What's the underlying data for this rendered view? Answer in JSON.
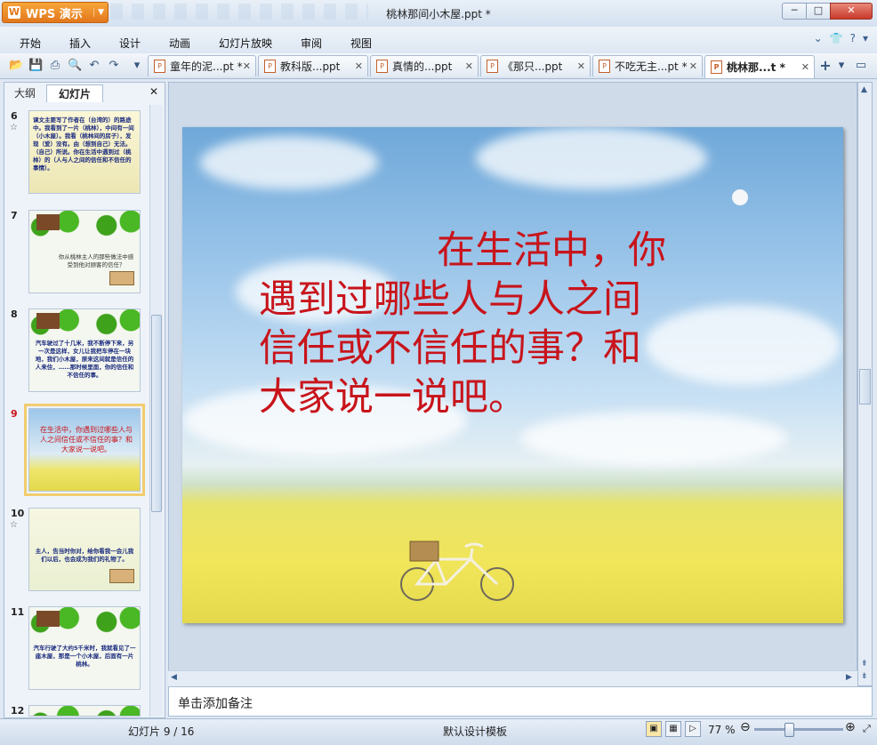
{
  "app": {
    "button_label": "WPS 演示",
    "window_title": "桃林那间小木屋.ppt *"
  },
  "window_controls": {
    "minimize": "─",
    "maximize": "□",
    "close": "✕"
  },
  "menu": [
    "开始",
    "插入",
    "设计",
    "动画",
    "幻灯片放映",
    "审阅",
    "视图"
  ],
  "doc_tabs": [
    {
      "label": "童年的泥...pt *"
    },
    {
      "label": "教科版...ppt"
    },
    {
      "label": "真情的...ppt"
    },
    {
      "label": "《那只...ppt"
    },
    {
      "label": "不吃无主...pt *"
    },
    {
      "label": "桃林那...t *",
      "active": true
    }
  ],
  "left_panel": {
    "tab_outline": "大纲",
    "tab_slides": "幻灯片",
    "close": "✕"
  },
  "slides": [
    {
      "num": "6",
      "star": "☆",
      "text": "课文主要写了作者在（台湾的）的路途中。我看到了一片（桃林），中间有一间（小木屋）。我看（桃林间的房子），发现（爱）没有。由（想到自己）无法。（自己）所说。你在生活中遇到过（桃林）的（人与人之间的信任和不信任的事情）。"
    },
    {
      "num": "7",
      "star": "",
      "text": "你从桃林主人的那些做法中感受到他对顾客的信任？"
    },
    {
      "num": "8",
      "star": "",
      "text": "汽车驶过了十几米，我不断停下来，另一次是这样，女儿让我把车停在一块地，我们小木屋，原来这间就是信任的人来住，……那时候里面，你的信任和不信任的事。"
    },
    {
      "num": "9",
      "star": "",
      "text": "在生活中，你遇到过哪些人与人之间信任或不信任的事？和大家说一说吧。"
    },
    {
      "num": "10",
      "star": "☆",
      "text": "主人，告当时你对，给你看我一会儿我们以后，也会成为我们的礼物了。"
    },
    {
      "num": "11",
      "star": "",
      "text": "汽车行驶了大约5千米时，我就看见了一座木屋，那是一个小木屋，后面有一片桃林。"
    },
    {
      "num": "12",
      "star": "",
      "text": ""
    }
  ],
  "slide": {
    "line1": "在生活中，你",
    "line2": "遇到过哪些人与人之间",
    "line3": "信任或不信任的事？和",
    "line4": "大家说一说吧。"
  },
  "notes_placeholder": "单击添加备注",
  "status": {
    "slide_counter": "幻灯片 9 / 16",
    "template": "默认设计模板",
    "zoom": "77 %"
  },
  "colors": {
    "slide_text": "#c8141b",
    "accent_orange": "#e2781c",
    "chrome_blue": "#dde7f3"
  }
}
